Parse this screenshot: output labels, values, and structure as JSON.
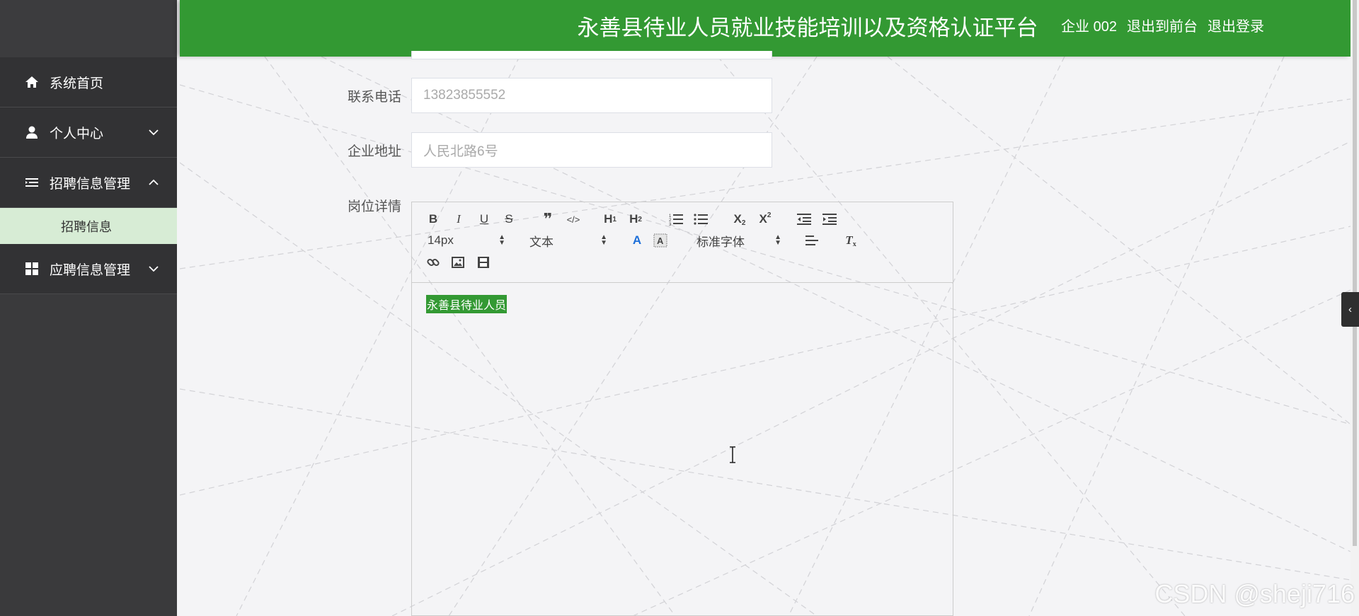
{
  "header": {
    "title": "永善县待业人员就业技能培训以及资格认证平台",
    "user": "企业 002",
    "back_front": "退出到前台",
    "logout": "退出登录"
  },
  "sidebar": {
    "items": [
      {
        "label": "系统首页"
      },
      {
        "label": "个人中心"
      },
      {
        "label": "招聘信息管理"
      },
      {
        "label": "应聘信息管理"
      }
    ],
    "sub_items": [
      {
        "label": "招聘信息"
      }
    ]
  },
  "form": {
    "phone": {
      "label": "联系电话",
      "value": "13823855552"
    },
    "address": {
      "label": "企业地址",
      "value": "人民北路6号"
    },
    "detail": {
      "label": "岗位详情"
    }
  },
  "editor": {
    "font_size": "14px",
    "format": "文本",
    "font_family": "标准字体",
    "content": "永善县待业人员"
  },
  "collapse_tab": "‹",
  "watermark": "CSDN @sheji716",
  "colors": {
    "brand": "#339933",
    "sidebar_bg": "#323234",
    "sub_item_bg": "#d7ecd5"
  }
}
